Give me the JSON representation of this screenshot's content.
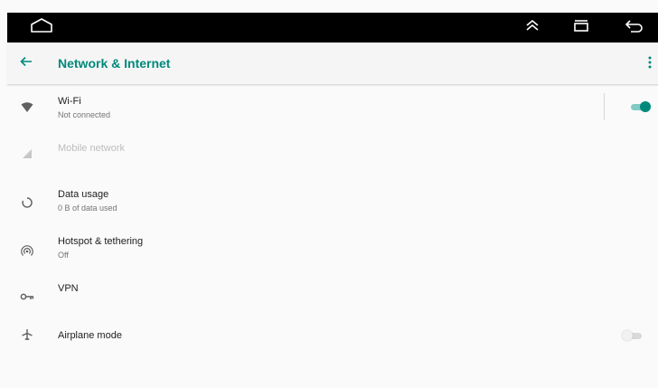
{
  "nav_bar": {
    "icons": [
      "home-icon",
      "expand-up-icon",
      "recents-icon",
      "back-arrow-icon"
    ]
  },
  "app_bar": {
    "title": "Network & Internet",
    "back_icon": "arrow-left-icon",
    "more_icon": "more-vert-icon"
  },
  "items": [
    {
      "title": "Wi-Fi",
      "subtitle": "Not connected",
      "icon": "wifi-icon",
      "toggle": true
    },
    {
      "title": "Mobile network",
      "subtitle": "",
      "icon": "signal-icon",
      "disabled": true
    },
    {
      "title": "Data usage",
      "subtitle": "0 B of data used",
      "icon": "data-usage-icon"
    },
    {
      "title": "Hotspot & tethering",
      "subtitle": "Off",
      "icon": "hotspot-icon"
    },
    {
      "title": "VPN",
      "subtitle": "",
      "icon": "vpn-key-icon"
    },
    {
      "title": "Airplane mode",
      "subtitle": "",
      "icon": "airplane-icon",
      "toggle": false
    }
  ],
  "colors": {
    "accent": "#00897b",
    "accent_light": "#80cbc4",
    "nav_bar": "#000000",
    "background": "#fafafa"
  }
}
